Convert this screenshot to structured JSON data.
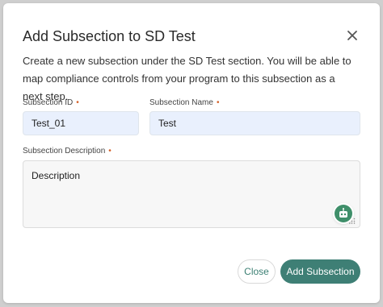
{
  "dialog": {
    "title": "Add Subsection to SD Test",
    "description": "Create a new subsection under the SD Test section. You will be able to map compliance controls from your program to this subsection as a next step."
  },
  "fields": {
    "subsection_id": {
      "label": "Subsection ID",
      "required_marker": "•",
      "value": "Test_01"
    },
    "subsection_name": {
      "label": "Subsection Name",
      "required_marker": "•",
      "value": "Test"
    },
    "subsection_description": {
      "label": "Subsection Description",
      "required_marker": "•",
      "value": "Description"
    }
  },
  "buttons": {
    "close_label": "Close",
    "add_label": "Add Subsection"
  },
  "icons": {
    "close": "close-icon",
    "assistant": "assistant-icon",
    "resize": "resize-handle-icon"
  },
  "colors": {
    "accent": "#3e7f75",
    "required": "#d4622a",
    "input_fill": "#e9f0fd"
  }
}
